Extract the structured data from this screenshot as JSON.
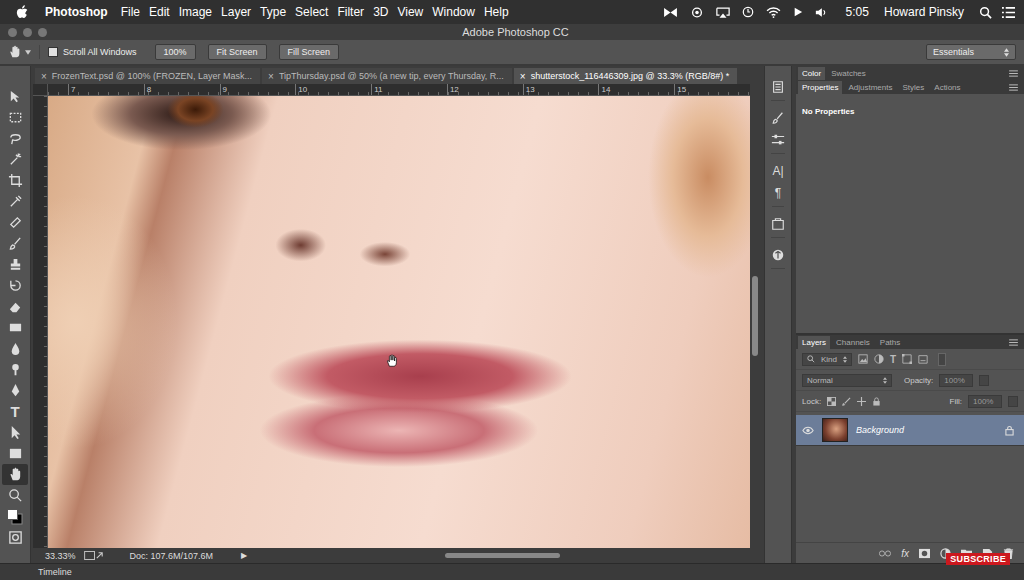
{
  "menubar": {
    "app": "Photoshop",
    "menus": [
      "File",
      "Edit",
      "Image",
      "Layer",
      "Type",
      "Select",
      "Filter",
      "3D",
      "View",
      "Window",
      "Help"
    ],
    "time": "5:05",
    "user": "Howard Pinsky"
  },
  "window": {
    "title": "Adobe Photoshop CC"
  },
  "options_bar": {
    "scroll_all_windows": {
      "label": "Scroll All Windows",
      "checked": false
    },
    "buttons": [
      "100%",
      "Fit Screen",
      "Fill Screen"
    ],
    "workspace": "Essentials"
  },
  "tabs": [
    {
      "label": "FrozenText.psd @ 100% (FROZEN, Layer Mask...",
      "close": "×",
      "selected": false
    },
    {
      "label": "TipThursday.psd @ 50% (a new tip, every Thursday, R...",
      "close": "×",
      "selected": false
    },
    {
      "label": "shutterstock_116446309.jpg @ 33.3% (RGB/8#) *",
      "close": "×",
      "selected": true
    }
  ],
  "ruler": {
    "ticks": [
      "7",
      "8",
      "9",
      "10",
      "11",
      "12",
      "13",
      "14",
      "15"
    ]
  },
  "tools": [
    {
      "selected": false
    },
    {
      "selected": false
    },
    {
      "selected": false
    },
    {
      "selected": false
    },
    {
      "selected": false
    },
    {
      "selected": false
    },
    {
      "selected": false
    },
    {
      "selected": false
    },
    {
      "selected": false
    },
    {
      "selected": false
    },
    {
      "selected": false
    },
    {
      "selected": false
    },
    {
      "selected": false
    },
    {
      "selected": false
    },
    {
      "selected": false
    },
    {
      "glyph": "T",
      "selected": false
    },
    {
      "selected": false
    },
    {
      "selected": false
    },
    {
      "selected": true
    },
    {
      "selected": false
    },
    {
      "selected": false
    },
    {
      "selected": false
    }
  ],
  "status_bar": {
    "zoom": "33.33%",
    "doc": "Doc: 107.6M/107.6M",
    "arrow": "▶"
  },
  "timeline": {
    "label": "Timeline"
  },
  "dock": {
    "character": "A|",
    "paragraph": "¶"
  },
  "color_panel": {
    "tabs": [
      {
        "label": "Color",
        "selected": true
      },
      {
        "label": "Swatches",
        "selected": false
      }
    ]
  },
  "properties_panel": {
    "tabs": [
      {
        "label": "Properties",
        "selected": true
      },
      {
        "label": "Adjustments",
        "selected": false
      },
      {
        "label": "Styles",
        "selected": false
      },
      {
        "label": "Actions",
        "selected": false
      }
    ],
    "message": "No Properties"
  },
  "layers_panel": {
    "tabs": [
      {
        "label": "Layers",
        "selected": true
      },
      {
        "label": "Channels",
        "selected": false
      },
      {
        "label": "Paths",
        "selected": false
      }
    ],
    "filter": "Kind",
    "filter_glyph": "T",
    "blend_mode": "Normal",
    "opacity_label": "Opacity:",
    "opacity": "100%",
    "lock_label": "Lock:",
    "fill_label": "Fill:",
    "fill": "100%",
    "layers": [
      {
        "name": "Background",
        "visible": true,
        "selected": true,
        "locked": true
      }
    ],
    "footer_fx": "fx"
  },
  "badge": "SUBSCRIBE"
}
